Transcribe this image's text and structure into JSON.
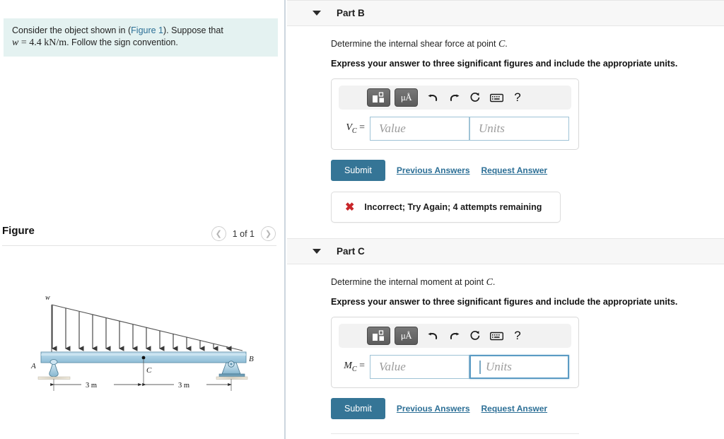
{
  "problem": {
    "line1_pre": "Consider the object shown in (",
    "figure_link": "Figure 1",
    "line1_post": "). Suppose that",
    "var_w": "w",
    "eq": "= 4.4",
    "units": "kN/m",
    "line2_post": ". Follow the sign convention."
  },
  "figure_panel": {
    "title": "Figure",
    "prev_icon": "chevron-left-icon",
    "next_icon": "chevron-right-icon",
    "counter": "1 of 1"
  },
  "figure": {
    "load_label": "w",
    "support_a_label": "A",
    "support_b_label": "B",
    "point_c_label": "C",
    "dim_left": "3 m",
    "dim_right": "3 m",
    "beam_fill": "#b7d7ea",
    "load_line_color": "#3a3a3a"
  },
  "toolbar": {
    "template_icon": "math-template-icon",
    "units_icon": "μÅ",
    "undo_icon": "undo-arrow-icon",
    "redo_icon": "redo-arrow-icon",
    "reset_icon": "reset-circular-arrow-icon",
    "keyboard_icon": "keyboard-icon",
    "help_icon": "?"
  },
  "common": {
    "instruction": "Express your answer to three significant figures and include the appropriate units.",
    "value_placeholder": "Value",
    "units_placeholder": "Units",
    "submit_label": "Submit",
    "previous_answers_label": "Previous Answers",
    "request_answer_label": "Request Answer"
  },
  "part_b": {
    "label": "Part B",
    "prompt_pre": "Determine the internal shear force at point ",
    "prompt_var": "C",
    "prompt_post": ".",
    "var_symbol": "V",
    "var_subscript": "C",
    "equals": "=",
    "value": "",
    "units": "",
    "feedback": {
      "icon": "x-mark-icon",
      "text": "Incorrect; Try Again; 4 attempts remaining"
    }
  },
  "part_c": {
    "label": "Part C",
    "prompt_pre": "Determine the internal moment at point ",
    "prompt_var": "C",
    "prompt_post": ".",
    "var_symbol": "M",
    "var_subscript": "C",
    "equals": "=",
    "value": "",
    "units": "",
    "units_focused": true
  }
}
